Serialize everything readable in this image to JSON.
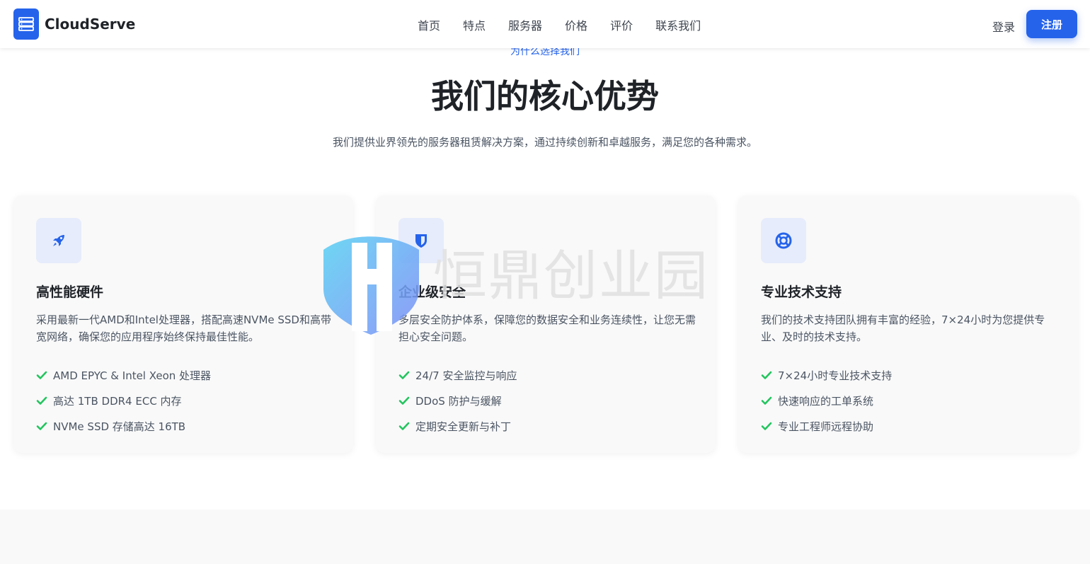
{
  "brand": {
    "name": "CloudServe"
  },
  "nav": {
    "items": [
      "首页",
      "特点",
      "服务器",
      "价格",
      "评价",
      "联系我们"
    ]
  },
  "auth": {
    "login_label": "登录",
    "register_label": "注册"
  },
  "section": {
    "eyebrow": "为什么选择我们",
    "title": "我们的核心优势",
    "subtitle": "我们提供业界领先的服务器租赁解决方案，通过持续创新和卓越服务，满足您的各种需求。"
  },
  "cards": [
    {
      "icon": "rocket-icon",
      "title": "高性能硬件",
      "desc": "采用最新一代AMD和Intel处理器，搭配高速NVMe SSD和高带宽网络，确保您的应用程序始终保持最佳性能。",
      "features": [
        "AMD EPYC & Intel Xeon 处理器",
        "高达 1TB DDR4 ECC 内存",
        "NVMe SSD 存储高达 16TB"
      ]
    },
    {
      "icon": "shield-icon",
      "title": "企业级安全",
      "desc": "多层安全防护体系，保障您的数据安全和业务连续性，让您无需担心安全问题。",
      "features": [
        "24/7 安全监控与响应",
        "DDoS 防护与缓解",
        "定期安全更新与补丁"
      ]
    },
    {
      "icon": "lifebuoy-icon",
      "title": "专业技术支持",
      "desc": "我们的技术支持团队拥有丰富的经验，7×24小时为您提供专业、及时的技术支持。",
      "features": [
        "7×24小时专业技术支持",
        "快速响应的工单系统",
        "专业工程师远程协助"
      ]
    }
  ],
  "watermark": {
    "text": "恒鼎创业园"
  },
  "colors": {
    "accent": "#2563eb",
    "check": "#22c55e",
    "card_bg": "#f9f9f9",
    "icon_bg": "#e6ecfb"
  }
}
